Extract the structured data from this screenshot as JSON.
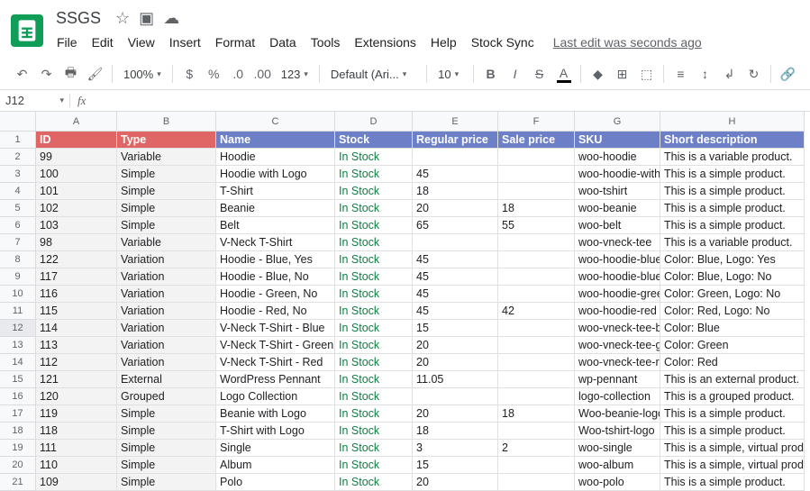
{
  "doc_title": "SSGS",
  "menu": [
    "File",
    "Edit",
    "View",
    "Insert",
    "Format",
    "Data",
    "Tools",
    "Extensions",
    "Help",
    "Stock Sync"
  ],
  "edit_status": "Last edit was seconds ago",
  "toolbar": {
    "zoom": "100%",
    "num_format": "123",
    "font": "Default (Ari...",
    "font_size": "10"
  },
  "namebox": "J12",
  "formula": "",
  "columns": [
    "A",
    "B",
    "C",
    "D",
    "E",
    "F",
    "G",
    "H"
  ],
  "header_row": [
    "ID",
    "Type",
    "Name",
    "Stock",
    "Regular price",
    "Sale price",
    "SKU",
    "Short description"
  ],
  "rows": [
    {
      "n": "2",
      "d": [
        "99",
        "Variable",
        "Hoodie",
        "In Stock",
        "",
        "",
        "woo-hoodie",
        "This is a variable product."
      ]
    },
    {
      "n": "3",
      "d": [
        "100",
        "Simple",
        "Hoodie with Logo",
        "In Stock",
        "45",
        "",
        "woo-hoodie-with",
        "This is a simple product."
      ]
    },
    {
      "n": "4",
      "d": [
        "101",
        "Simple",
        "T-Shirt",
        "In Stock",
        "18",
        "",
        "woo-tshirt",
        "This is a simple product."
      ]
    },
    {
      "n": "5",
      "d": [
        "102",
        "Simple",
        "Beanie",
        "In Stock",
        "20",
        "18",
        "woo-beanie",
        "This is a simple product."
      ]
    },
    {
      "n": "6",
      "d": [
        "103",
        "Simple",
        "Belt",
        "In Stock",
        "65",
        "55",
        "woo-belt",
        "This is a simple product."
      ]
    },
    {
      "n": "7",
      "d": [
        "98",
        "Variable",
        "V-Neck T-Shirt",
        "In Stock",
        "",
        "",
        "woo-vneck-tee",
        "This is a variable product."
      ]
    },
    {
      "n": "8",
      "d": [
        "122",
        "Variation",
        "Hoodie - Blue, Yes",
        "In Stock",
        "45",
        "",
        "woo-hoodie-blue",
        "Color: Blue, Logo: Yes"
      ]
    },
    {
      "n": "9",
      "d": [
        "117",
        "Variation",
        "Hoodie - Blue, No",
        "In Stock",
        "45",
        "",
        "woo-hoodie-blue",
        "Color: Blue, Logo: No"
      ]
    },
    {
      "n": "10",
      "d": [
        "116",
        "Variation",
        "Hoodie - Green, No",
        "In Stock",
        "45",
        "",
        "woo-hoodie-gree",
        "Color: Green, Logo: No"
      ]
    },
    {
      "n": "11",
      "d": [
        "115",
        "Variation",
        "Hoodie - Red, No",
        "In Stock",
        "45",
        "42",
        "woo-hoodie-red",
        "Color: Red, Logo: No"
      ]
    },
    {
      "n": "12",
      "d": [
        "114",
        "Variation",
        "V-Neck T-Shirt - Blue",
        "In Stock",
        "15",
        "",
        "woo-vneck-tee-b",
        "Color: Blue"
      ]
    },
    {
      "n": "13",
      "d": [
        "113",
        "Variation",
        "V-Neck T-Shirt - Green",
        "In Stock",
        "20",
        "",
        "woo-vneck-tee-g",
        "Color: Green"
      ]
    },
    {
      "n": "14",
      "d": [
        "112",
        "Variation",
        "V-Neck T-Shirt - Red",
        "In Stock",
        "20",
        "",
        "woo-vneck-tee-re",
        "Color: Red"
      ]
    },
    {
      "n": "15",
      "d": [
        "121",
        "External",
        "WordPress Pennant",
        "In Stock",
        "11.05",
        "",
        "wp-pennant",
        "This is an external product."
      ]
    },
    {
      "n": "16",
      "d": [
        "120",
        "Grouped",
        "Logo Collection",
        "In Stock",
        "",
        "",
        "logo-collection",
        "This is a grouped product."
      ]
    },
    {
      "n": "17",
      "d": [
        "119",
        "Simple",
        "Beanie with Logo",
        "In Stock",
        "20",
        "18",
        "Woo-beanie-logo",
        "This is a simple product."
      ]
    },
    {
      "n": "18",
      "d": [
        "118",
        "Simple",
        "T-Shirt with Logo",
        "In Stock",
        "18",
        "",
        "Woo-tshirt-logo",
        "This is a simple product."
      ]
    },
    {
      "n": "19",
      "d": [
        "111",
        "Simple",
        "Single",
        "In Stock",
        "3",
        "2",
        "woo-single",
        "This is a simple, virtual product."
      ]
    },
    {
      "n": "20",
      "d": [
        "110",
        "Simple",
        "Album",
        "In Stock",
        "15",
        "",
        "woo-album",
        "This is a simple, virtual product."
      ]
    },
    {
      "n": "21",
      "d": [
        "109",
        "Simple",
        "Polo",
        "In Stock",
        "20",
        "",
        "woo-polo",
        "This is a simple product."
      ]
    }
  ]
}
